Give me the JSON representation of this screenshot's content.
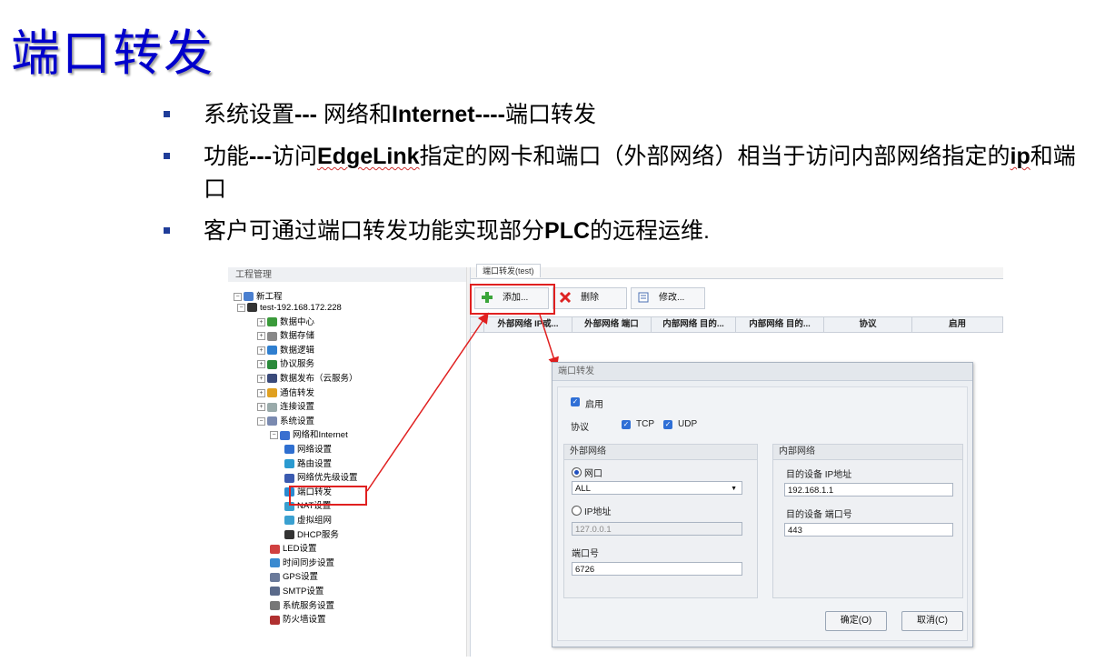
{
  "slide": {
    "title": "端口转发",
    "bullets": [
      {
        "parts": [
          {
            "t": "系统设置",
            "b": false
          },
          {
            "t": "--- ",
            "b": true
          },
          {
            "t": "网络和",
            "b": false
          },
          {
            "t": "Internet----",
            "b": true
          },
          {
            "t": "端口转发",
            "b": false
          }
        ]
      },
      {
        "parts": [
          {
            "t": "功能",
            "b": false
          },
          {
            "t": "---",
            "b": true
          },
          {
            "t": "访问",
            "b": false
          },
          {
            "t": "EdgeLink",
            "b": true,
            "squig": true
          },
          {
            "t": "指定的网卡和端口（外部网络）相当于访问内部网络指定的",
            "b": false
          },
          {
            "t": "ip",
            "b": true,
            "squig": true
          },
          {
            "t": "和端口",
            "b": false
          }
        ]
      },
      {
        "parts": [
          {
            "t": "客户可通过端口转发功能实现部分",
            "b": false
          },
          {
            "t": "PLC",
            "b": true
          },
          {
            "t": "的远程运维.",
            "b": false
          }
        ]
      }
    ]
  },
  "left_pane": {
    "header": "工程管理",
    "tree": [
      {
        "label": "新工程",
        "icon": "project-icon",
        "level": 0
      },
      {
        "label": "test-192.168.172.228",
        "icon": "device-icon",
        "level": 1
      },
      {
        "label": "数据中心",
        "icon": "data-center-icon",
        "level": 2
      },
      {
        "label": "数据存储",
        "icon": "storage-icon",
        "level": 2
      },
      {
        "label": "数据逻辑",
        "icon": "logic-icon",
        "level": 2
      },
      {
        "label": "协议服务",
        "icon": "protocol-icon",
        "level": 2
      },
      {
        "label": "数据发布（云服务）",
        "icon": "cloud-icon",
        "level": 2
      },
      {
        "label": "通信转发",
        "icon": "forward-icon",
        "level": 2
      },
      {
        "label": "连接设置",
        "icon": "connect-icon",
        "level": 2
      },
      {
        "label": "系统设置",
        "icon": "system-icon",
        "level": 2
      },
      {
        "label": "网络和Internet",
        "icon": "network-icon",
        "level": 3
      },
      {
        "label": "网络设置",
        "icon": "globe-icon",
        "level": 4
      },
      {
        "label": "路由设置",
        "icon": "router-icon",
        "level": 4
      },
      {
        "label": "网络优先级设置",
        "icon": "priority-icon",
        "level": 4
      },
      {
        "label": "端口转发",
        "icon": "port-forward-icon",
        "level": 4
      },
      {
        "label": "NAT设置",
        "icon": "nat-icon",
        "level": 4
      },
      {
        "label": "虚拟组网",
        "icon": "vpn-icon",
        "level": 4
      },
      {
        "label": "DHCP服务",
        "icon": "dhcp-icon",
        "level": 4
      },
      {
        "label": "LED设置",
        "icon": "led-icon",
        "level": 3
      },
      {
        "label": "时间同步设置",
        "icon": "clock-icon",
        "level": 3
      },
      {
        "label": "GPS设置",
        "icon": "gps-icon",
        "level": 3
      },
      {
        "label": "SMTP设置",
        "icon": "mail-icon",
        "level": 3
      },
      {
        "label": "系统服务设置",
        "icon": "service-icon",
        "level": 3
      },
      {
        "label": "防火墙设置",
        "icon": "firewall-icon",
        "level": 3
      }
    ]
  },
  "right_pane": {
    "tab_label": "端口转发(test)",
    "toolbar": {
      "add": "添加...",
      "delete": "删除",
      "edit": "修改..."
    },
    "columns": [
      "外部网络 IP或...",
      "外部网络 端口",
      "内部网络 目的...",
      "内部网络 目的...",
      "协议",
      "启用"
    ]
  },
  "dialog": {
    "title": "端口转发",
    "enable_label": "启用",
    "protocol_label": "协议",
    "tcp_label": "TCP",
    "udp_label": "UDP",
    "external": {
      "header": "外部网络",
      "iface_label": "网口",
      "iface_value": "ALL",
      "ip_label": "IP地址",
      "ip_value": "127.0.0.1",
      "port_label": "端口号",
      "port_value": "6726"
    },
    "internal": {
      "header": "内部网络",
      "ip_label": "目的设备 IP地址",
      "ip_value": "192.168.1.1",
      "port_label": "目的设备 端口号",
      "port_value": "443"
    },
    "ok": "确定(O)",
    "cancel": "取消(C)"
  },
  "colors": {
    "title": "#0000cc",
    "highlight": "#e02020",
    "checkbox": "#2f6fd6"
  }
}
